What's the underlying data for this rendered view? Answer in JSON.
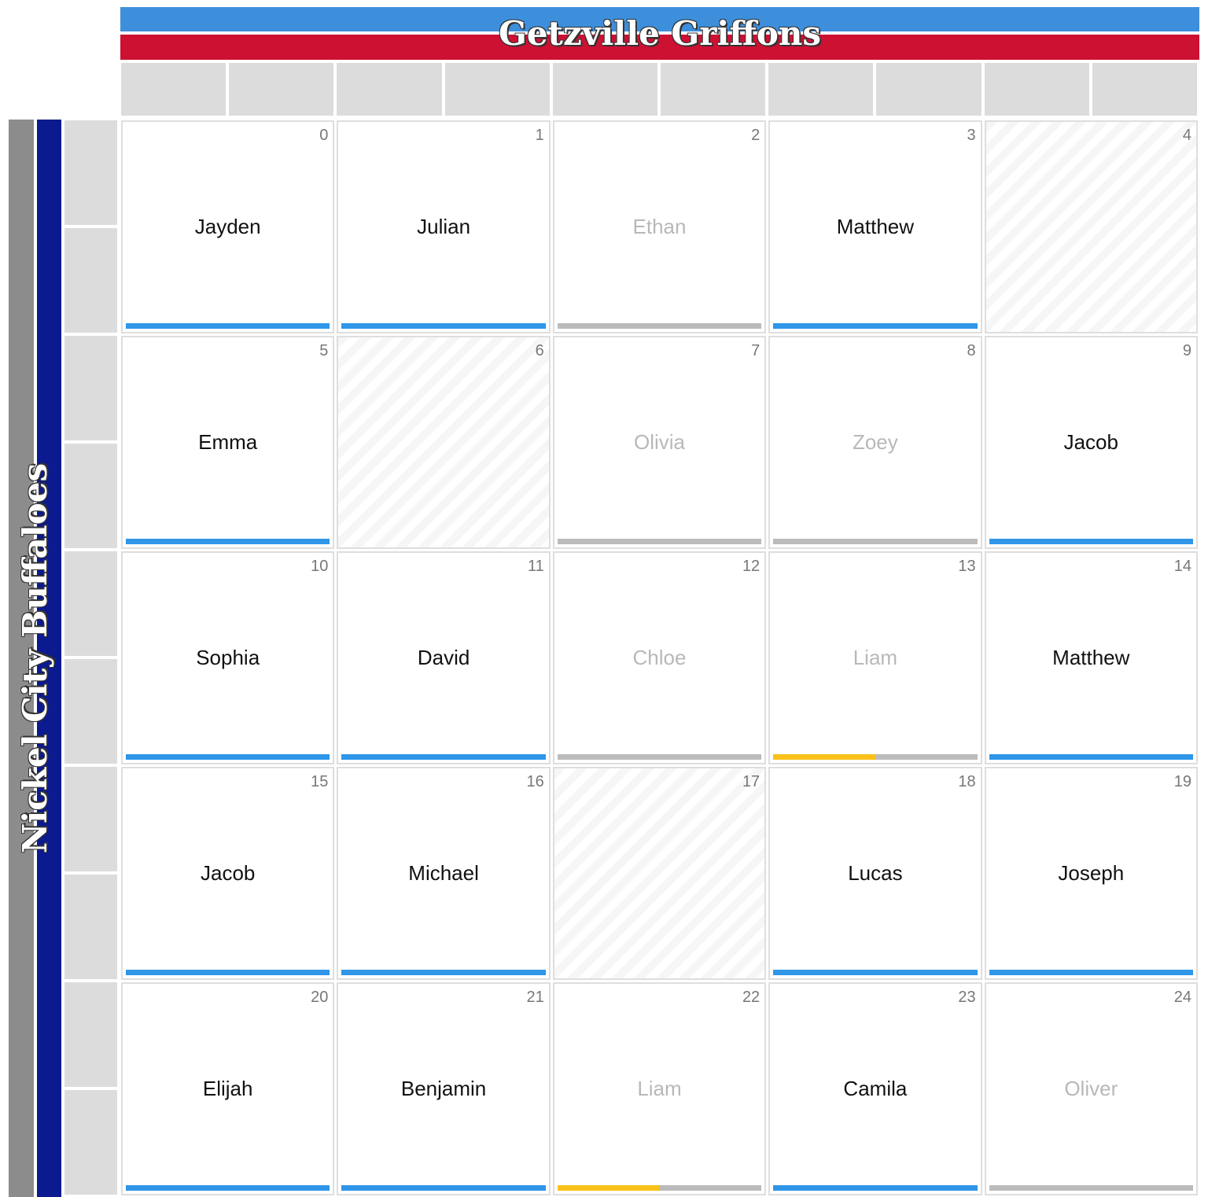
{
  "home_team": {
    "name": "Getzville Griffons",
    "colors": [
      "#3d8fdc",
      "#cc1133"
    ]
  },
  "away_team": {
    "name": "Nickel City Buffaloes",
    "colors": [
      "#8c8c8c",
      "#0b1a8f"
    ]
  },
  "colors": {
    "claimed": "#2f96e8",
    "pending": "#f9c11a",
    "empty": "#bbbbbb"
  },
  "squares": [
    {
      "number": "0",
      "name": "Jayden",
      "state": "claimed",
      "progress": 1
    },
    {
      "number": "1",
      "name": "Julian",
      "state": "claimed",
      "progress": 1
    },
    {
      "number": "2",
      "name": "Ethan",
      "state": "faded",
      "progress": 0
    },
    {
      "number": "3",
      "name": "Matthew",
      "state": "claimed",
      "progress": 1
    },
    {
      "number": "4",
      "name": "",
      "state": "unavailable",
      "progress": null
    },
    {
      "number": "5",
      "name": "Emma",
      "state": "claimed",
      "progress": 1
    },
    {
      "number": "6",
      "name": "",
      "state": "unavailable",
      "progress": null
    },
    {
      "number": "7",
      "name": "Olivia",
      "state": "faded",
      "progress": 0
    },
    {
      "number": "8",
      "name": "Zoey",
      "state": "faded",
      "progress": 0
    },
    {
      "number": "9",
      "name": "Jacob",
      "state": "claimed",
      "progress": 1
    },
    {
      "number": "10",
      "name": "Sophia",
      "state": "claimed",
      "progress": 1
    },
    {
      "number": "11",
      "name": "David",
      "state": "claimed",
      "progress": 1
    },
    {
      "number": "12",
      "name": "Chloe",
      "state": "faded",
      "progress": 0
    },
    {
      "number": "13",
      "name": "Liam",
      "state": "pending",
      "progress": 0.5
    },
    {
      "number": "14",
      "name": "Matthew",
      "state": "claimed",
      "progress": 1
    },
    {
      "number": "15",
      "name": "Jacob",
      "state": "claimed",
      "progress": 1
    },
    {
      "number": "16",
      "name": "Michael",
      "state": "claimed",
      "progress": 1
    },
    {
      "number": "17",
      "name": "",
      "state": "unavailable",
      "progress": null
    },
    {
      "number": "18",
      "name": "Lucas",
      "state": "claimed",
      "progress": 1
    },
    {
      "number": "19",
      "name": "Joseph",
      "state": "claimed",
      "progress": 1
    },
    {
      "number": "20",
      "name": "Elijah",
      "state": "claimed",
      "progress": 1
    },
    {
      "number": "21",
      "name": "Benjamin",
      "state": "claimed",
      "progress": 1
    },
    {
      "number": "22",
      "name": "Liam",
      "state": "pending",
      "progress": 0.5
    },
    {
      "number": "23",
      "name": "Camila",
      "state": "claimed",
      "progress": 1
    },
    {
      "number": "24",
      "name": "Oliver",
      "state": "faded",
      "progress": 0
    }
  ]
}
